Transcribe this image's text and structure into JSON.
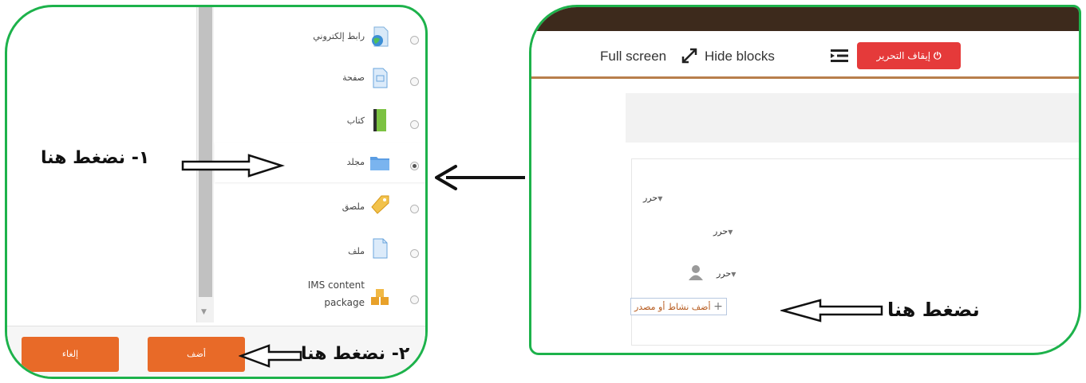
{
  "left_panel": {
    "modules": [
      {
        "label": "رابط إلكتروني",
        "icon": "url-globe-icon",
        "selected": false
      },
      {
        "label": "صفحة",
        "icon": "page-icon",
        "selected": false
      },
      {
        "label": "كتاب",
        "icon": "book-icon",
        "selected": false
      },
      {
        "label": "مجلد",
        "icon": "folder-icon",
        "selected": true
      },
      {
        "label": "ملصق",
        "icon": "label-tag-icon",
        "selected": false
      },
      {
        "label": "ملف",
        "icon": "file-icon",
        "selected": false
      },
      {
        "label": "IMS content package",
        "icon": "ims-package-icon",
        "selected": false
      }
    ],
    "add_button": "أضف",
    "cancel_button": "إلغاء",
    "annotation_step1": "١- نضغط هنا",
    "annotation_step2": "٢- نضغط هنا"
  },
  "right_panel": {
    "full_screen": "Full screen",
    "hide_blocks": "Hide blocks",
    "stop_editing": "إيقاف التحرير",
    "edit_1": "حرر",
    "edit_2": "حرر",
    "edit_3": "حرر",
    "add_activity": "أضف نشاط أو مصدر",
    "annotation": "نضغط هنا"
  },
  "colors": {
    "frame_green": "#1db24b",
    "button_orange": "#e86a28",
    "stop_red": "#e53a3a",
    "topbar_brown": "#3d2a1c",
    "toolbar_line": "#b87f4c"
  }
}
